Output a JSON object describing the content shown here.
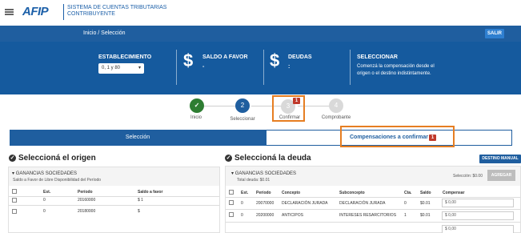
{
  "header": {
    "logo": "AFIP",
    "system_line1": "SISTEMA DE CUENTAS TRIBUTARIAS",
    "system_line2": "CONTRIBUYENTE"
  },
  "nav": {
    "breadcrumb": "Inicio / Selección",
    "exit_label": "SALIR"
  },
  "info_panel": {
    "establecimiento_label": "ESTABLECIMIENTO",
    "establecimiento_value": "0, 1 y 80",
    "saldo_label": "SALDO A FAVOR",
    "saldo_value": "-",
    "deudas_label": "DEUDAS",
    "deudas_value": ":",
    "seleccionar_label": "SELECCIONAR",
    "seleccionar_text1": "Comenzá la compensación desde el",
    "seleccionar_text2": "origen o el destino indistintamente.",
    "dollar_symbol": "$"
  },
  "steps": [
    {
      "number": "✓",
      "label": "Inicio",
      "state": "done"
    },
    {
      "number": "2",
      "label": "Seleccionar",
      "state": "active"
    },
    {
      "number": "3",
      "label": "Confirmar",
      "state": "pending",
      "badge": "1"
    },
    {
      "number": "4",
      "label": "Comprobante",
      "state": "pending"
    }
  ],
  "tabs": {
    "seleccion": "Selección",
    "compensaciones": "Compensaciones a confirmar",
    "compensaciones_badge": "1"
  },
  "origen": {
    "title": "Seleccioná el origen",
    "group_title": "GANANCIAS SOCIEDADES",
    "group_subtitle": "Saldo a Favor de Libre Disponibilidad del Período",
    "columns": [
      "Est.",
      "Período",
      "Saldo a favor"
    ],
    "rows": [
      {
        "est": "0",
        "periodo": "20160000",
        "saldo": "$ 1"
      },
      {
        "est": "0",
        "periodo": "20180000",
        "saldo": "$"
      }
    ]
  },
  "deuda": {
    "title": "Seleccioná la deuda",
    "destino_button": "DESTINO MANUAL",
    "group_title": "GANANCIAS SOCIEDADES",
    "total": "Total deuda: $0.01",
    "seleccion": "Selección: $0.00",
    "agregar": "AGREGAR",
    "columns": [
      "Est.",
      "Período",
      "Concepto",
      "Subconcepto",
      "Cta.",
      "Saldo",
      "Compensar"
    ],
    "rows": [
      {
        "est": "0",
        "periodo": "20070000",
        "concepto": "DECLARACIÓN JURADA",
        "subconcepto": "DECLARACIÓN JURADA",
        "cta": "0",
        "saldo": "$0.01",
        "compensar": "$ 0,00"
      },
      {
        "est": "0",
        "periodo": "20200000",
        "concepto": "ANTICIPOS",
        "subconcepto": "INTERESES RESARCITORIOS",
        "cta": "1",
        "saldo": "$0.01",
        "compensar": "$ 0,00"
      }
    ],
    "extra_input": "$ 0,00"
  },
  "colors": {
    "brand_blue": "#1f5e9f",
    "panel_blue": "#155a9e",
    "done_green": "#2e7d32",
    "highlight_orange": "#e67e22",
    "badge_red": "#c0392b"
  }
}
